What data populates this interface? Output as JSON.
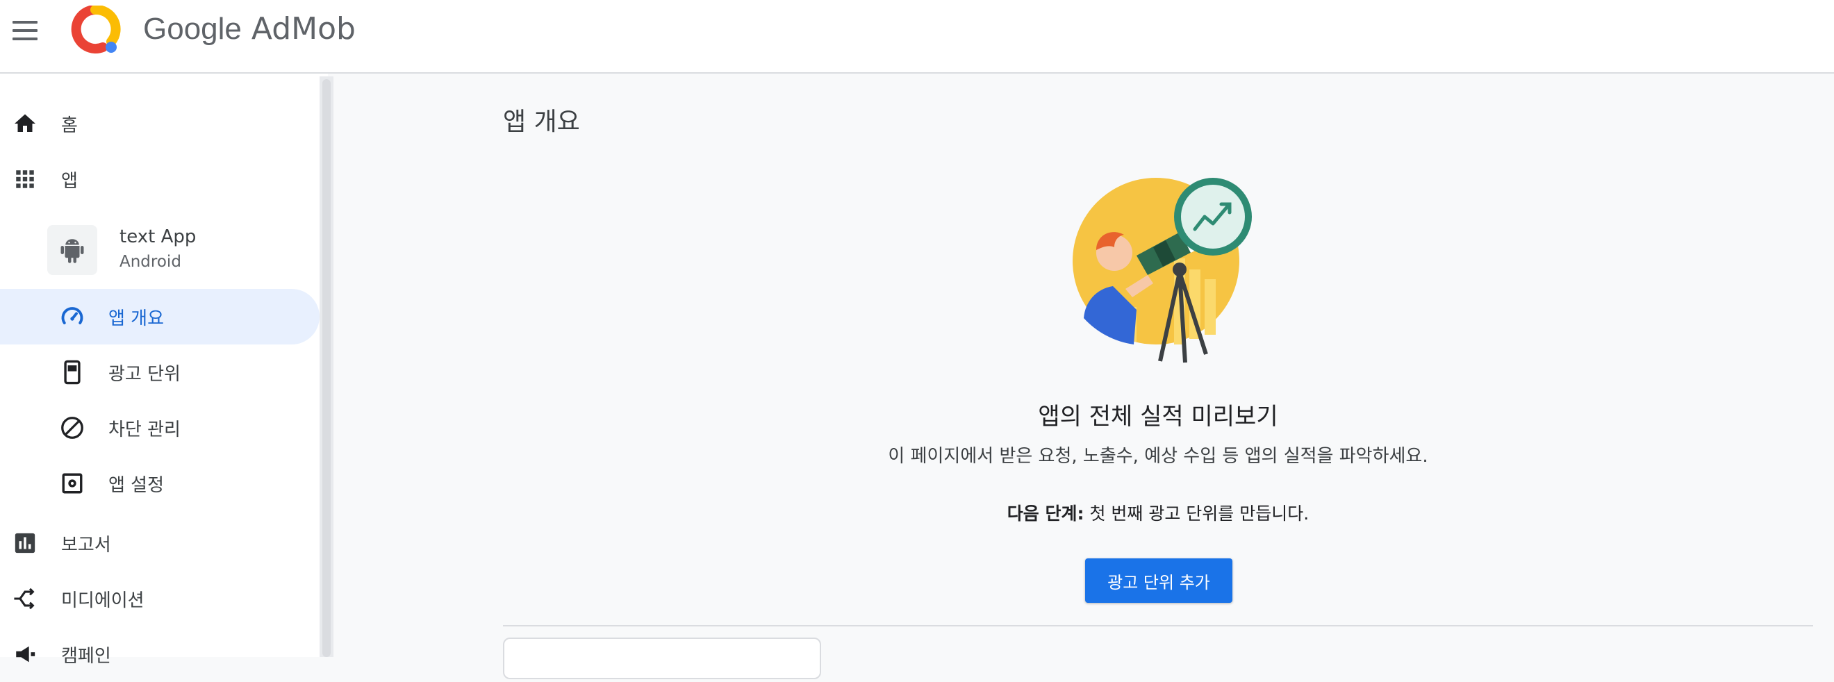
{
  "header": {
    "brand_google": "Google",
    "brand_product": "AdMob",
    "icons": {
      "menu": "hamburger-menu-icon",
      "logo": "admob-logo"
    }
  },
  "sidebar": {
    "items": [
      {
        "label": "홈",
        "icon": "home-icon"
      },
      {
        "label": "앱",
        "icon": "apps-grid-icon"
      }
    ],
    "app": {
      "name": "text App",
      "platform": "Android",
      "icon": "android-icon"
    },
    "sub_items": [
      {
        "label": "앱 개요",
        "icon": "speedometer-icon",
        "active": true
      },
      {
        "label": "광고 단위",
        "icon": "ad-unit-icon"
      },
      {
        "label": "차단 관리",
        "icon": "block-icon"
      },
      {
        "label": "앱 설정",
        "icon": "app-settings-icon"
      }
    ],
    "bottom_items": [
      {
        "label": "보고서",
        "icon": "bar-chart-icon"
      },
      {
        "label": "미디에이션",
        "icon": "mediation-icon"
      },
      {
        "label": "캠페인",
        "icon": "megaphone-icon"
      }
    ]
  },
  "main": {
    "page_title": "앱 개요",
    "empty_state": {
      "title": "앱의 전체 실적 미리보기",
      "description": "이 페이지에서 받은 요청, 노출수, 예상 수입 등 앱의 실적을 파악하세요.",
      "next_step_prefix": "다음 단계:",
      "next_step_text": " 첫 번째 광고 단위를 만듭니다.",
      "button_label": "광고 단위 추가"
    }
  },
  "colors": {
    "accent": "#1a73e8",
    "active_bg": "#e8f0fe",
    "active_text": "#1967d2"
  }
}
